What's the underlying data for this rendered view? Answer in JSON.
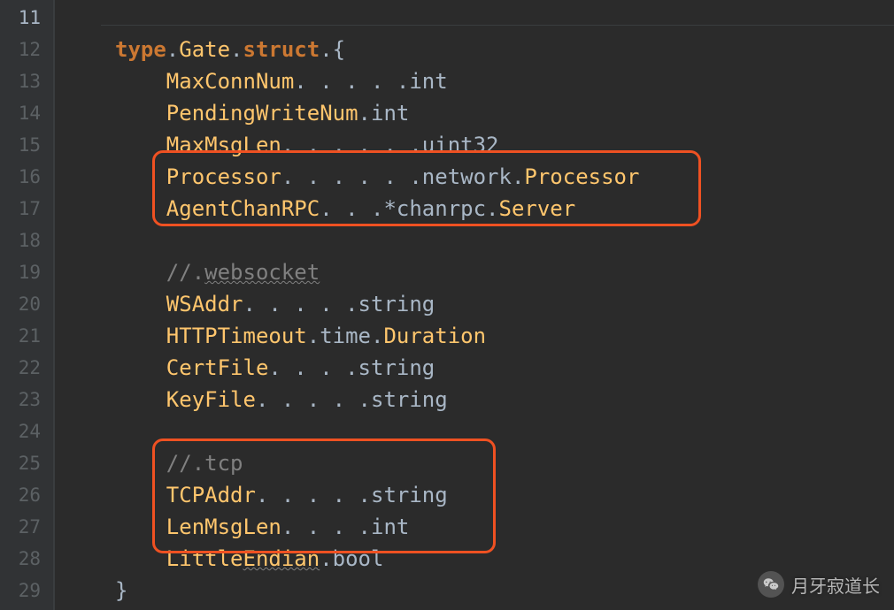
{
  "gutter": {
    "start": 11,
    "end": 29
  },
  "code": {
    "l12": {
      "kw1": "type",
      "name": "Gate",
      "kw2": "struct",
      "brace": "{"
    },
    "l13": {
      "field": "MaxConnNum",
      "dots": ". . . . .",
      "type": "int"
    },
    "l14": {
      "field": "PendingWriteNum",
      "dots": ".",
      "type": "int"
    },
    "l15": {
      "field": "MaxMsgLen",
      "dots": ". . . . . .",
      "type": "uint32"
    },
    "l16": {
      "field": "Processor",
      "dots": ". . . . . .",
      "pkg": "network",
      "type": "Processor"
    },
    "l17": {
      "field": "AgentChanRPC",
      "dots": ". . .",
      "star": "*",
      "pkg": "chanrpc",
      "type": "Server"
    },
    "l19": {
      "comment_pre": "//.",
      "comment_txt": "websocket"
    },
    "l20": {
      "field": "WSAddr",
      "dots": ". . . . .",
      "type": "string"
    },
    "l21": {
      "field": "HTTPTimeout",
      "dots": ".",
      "pkg": "time",
      "type": "Duration"
    },
    "l22": {
      "field": "CertFile",
      "dots": ". . . .",
      "type": "string"
    },
    "l23": {
      "field": "KeyFile",
      "dots": ". . . . .",
      "type": "string"
    },
    "l25": {
      "comment_pre": "//.",
      "comment_txt": "tcp"
    },
    "l26": {
      "field": "TCPAddr",
      "dots": ". . . . .",
      "type": "string"
    },
    "l27": {
      "field": "LenMsgLen",
      "dots": ". . . .",
      "type": "int"
    },
    "l28": {
      "field": "LittleEndian",
      "dots": ".",
      "type": "bool"
    },
    "l29": {
      "brace": "}"
    }
  },
  "watermark": {
    "text": "月牙寂道长"
  }
}
